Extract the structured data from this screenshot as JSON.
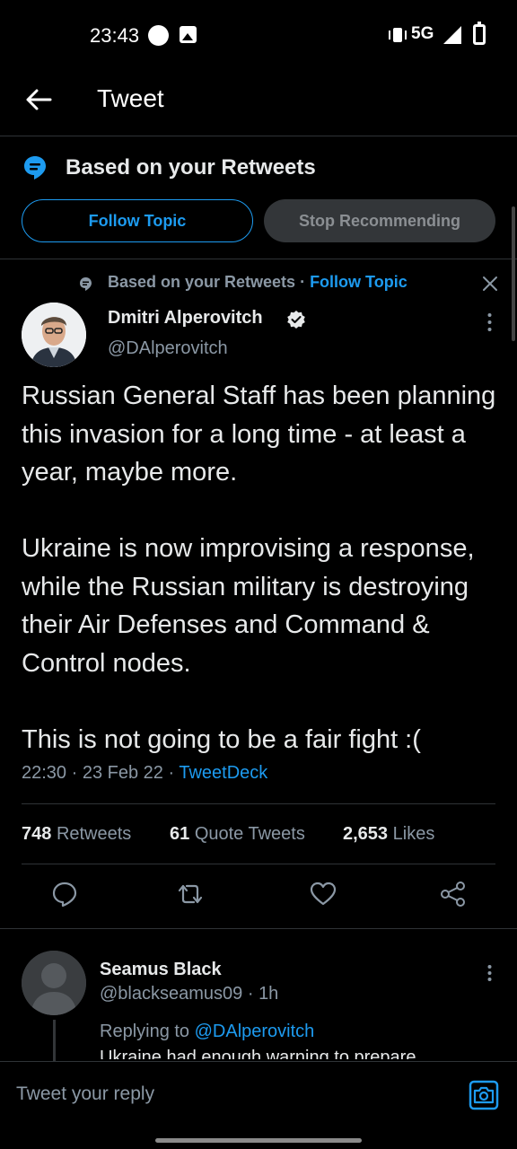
{
  "status_bar": {
    "time": "23:43",
    "network": "5G"
  },
  "header": {
    "title": "Tweet"
  },
  "topic": {
    "title": "Based on your Retweets",
    "follow_label": "Follow Topic",
    "stop_label": "Stop Recommending"
  },
  "tweet": {
    "context": "Based on your Retweets",
    "context_sep": " · ",
    "context_link": "Follow Topic",
    "author_name": "Dmitri Alperovitch",
    "author_handle": "@DAlperovitch",
    "paragraphs": [
      "Russian General Staff has been planning this invasion for a long time - at least a year, maybe more.",
      "Ukraine is now improvising a response, while the Russian military is destroying their Air Defenses and Command & Control nodes.",
      "This is not going to be a fair fight :("
    ],
    "time": "22:30",
    "date": "23 Feb 22",
    "source": "TweetDeck",
    "meta_sep": " · ",
    "retweets_count": "748",
    "retweets_label": "Retweets",
    "quotes_count": "61",
    "quotes_label": "Quote Tweets",
    "likes_count": "2,653",
    "likes_label": "Likes",
    "accent_color": "#1d9bf0"
  },
  "reply": {
    "author_name": "Seamus Black",
    "author_handle": "@blackseamus09",
    "age": "1h",
    "replying_prefix": "Replying to ",
    "replying_to": "@DAlperovitch",
    "preview": "Ukraine had enough warning to prepare"
  },
  "composer": {
    "placeholder": "Tweet your reply"
  }
}
